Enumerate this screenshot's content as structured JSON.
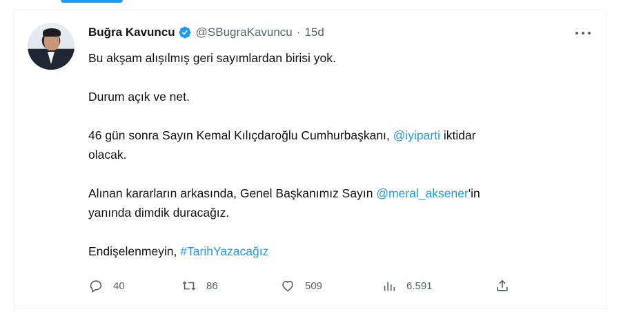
{
  "tweet": {
    "author_name": "Buğra Kavuncu",
    "handle": "@SBugraKavuncu",
    "separator": "·",
    "time": "15d",
    "lines": {
      "l1": "Bu akşam alışılmış geri sayımlardan birisi yok.",
      "l2": "Durum açık ve net.",
      "l3_pre": "46 gün sonra Sayın Kemal Kılıçdaroğlu Cumhurbaşkanı, ",
      "l3_mention": "@iyiparti",
      "l3_post": " iktidar",
      "l4": "olacak.",
      "l5_pre": "Alınan kararların arkasında, Genel Başkanımız Sayın ",
      "l5_mention": "@meral_aksener",
      "l5_post": "'in",
      "l6": "yanında dimdik duracağız.",
      "l7_pre": "Endişelenmeyin, ",
      "l7_hashtag": "#TarihYazacağız"
    },
    "stats": {
      "replies": "40",
      "retweets": "86",
      "likes": "509",
      "views": "6.591"
    },
    "icons": {
      "reply": "reply-icon",
      "retweet": "retweet-icon",
      "like": "like-icon",
      "views": "views-icon",
      "share": "share-icon",
      "more": "more-icon",
      "verified": "verified-badge-icon"
    },
    "colors": {
      "accent": "#1d9bf0",
      "text": "#0f1419",
      "muted": "#536471"
    }
  }
}
